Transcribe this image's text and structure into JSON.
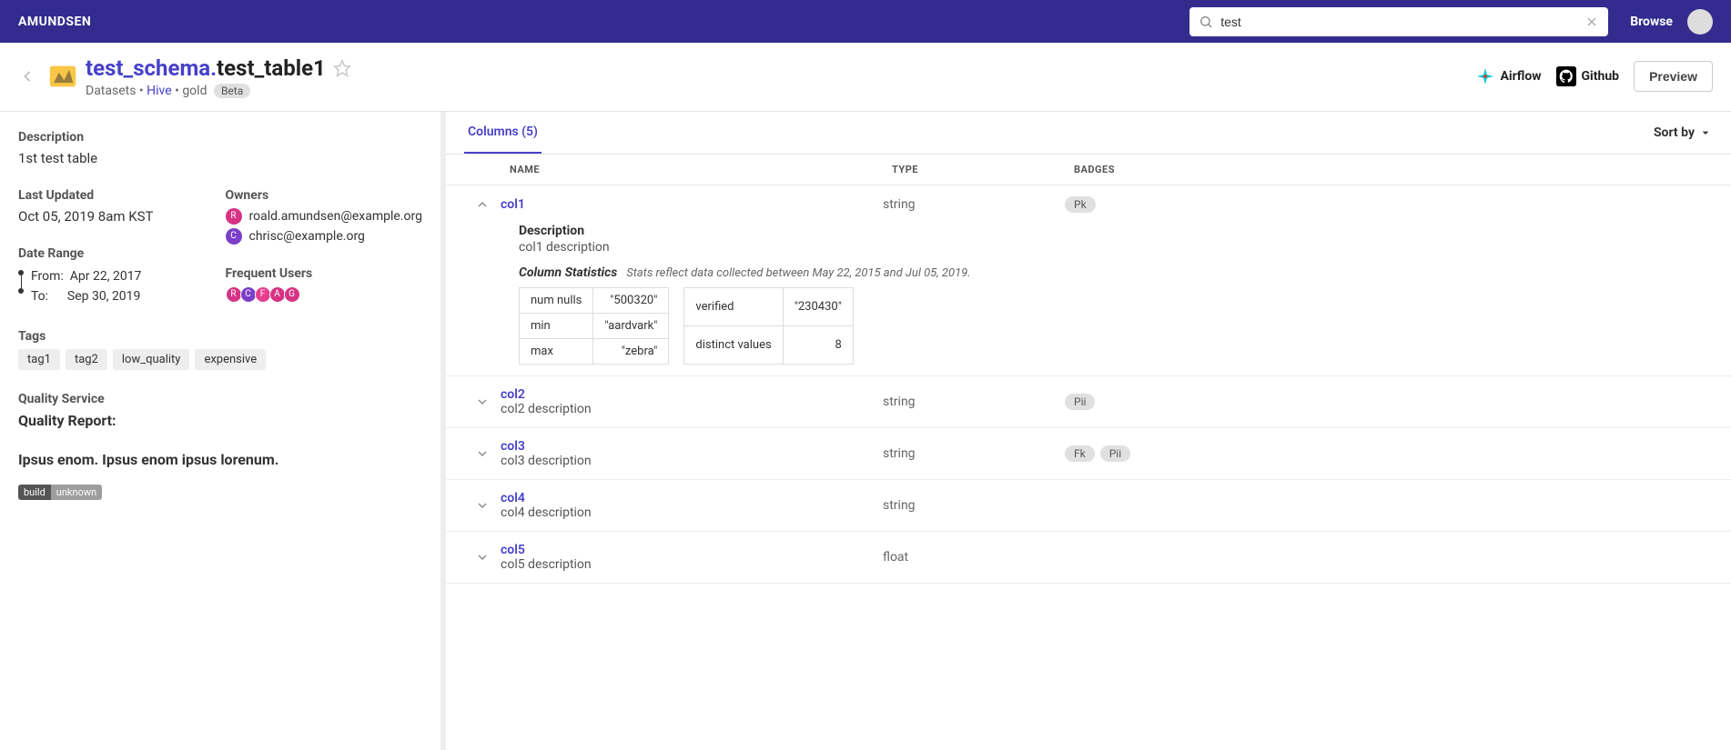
{
  "navbar": {
    "brand": "AMUNDSEN",
    "search_value": "test",
    "browse": "Browse"
  },
  "header": {
    "schema": "test_schema",
    "table": "test_table1",
    "breadcrumb_prefix": "Datasets",
    "breadcrumb_db": "Hive",
    "breadcrumb_tier": "gold",
    "beta": "Beta",
    "airflow": "Airflow",
    "github": "Github",
    "preview": "Preview"
  },
  "left": {
    "description_label": "Description",
    "description": "1st test table",
    "last_updated_label": "Last Updated",
    "last_updated": "Oct 05, 2019 8am KST",
    "owners_label": "Owners",
    "owners": [
      {
        "initial": "R",
        "class": "avatar-R",
        "email": "roald.amundsen@example.org"
      },
      {
        "initial": "C",
        "class": "avatar-C",
        "email": "chrisc@example.org"
      }
    ],
    "date_range_label": "Date Range",
    "date_from_label": "From:",
    "date_from": "Apr 22, 2017",
    "date_to_label": "To:",
    "date_to": "Sep 30, 2019",
    "freq_users_label": "Frequent Users",
    "freq_users": [
      {
        "initial": "R",
        "class": "avatar-R"
      },
      {
        "initial": "C",
        "class": "avatar-C"
      },
      {
        "initial": "F",
        "class": "avatar-F"
      },
      {
        "initial": "A",
        "class": "avatar-A"
      },
      {
        "initial": "G",
        "class": "avatar-G"
      }
    ],
    "tags_label": "Tags",
    "tags": [
      "tag1",
      "tag2",
      "low_quality",
      "expensive"
    ],
    "quality_service_label": "Quality Service",
    "quality_report": "Quality Report:",
    "ipsum": "Ipsus enom. Ipsus enom ipsus lorenum.",
    "build_left": "build",
    "build_right": "unknown"
  },
  "right": {
    "tab_columns": "Columns (5)",
    "sort_by": "Sort by",
    "headers": {
      "name": "NAME",
      "type": "TYPE",
      "badges": "BADGES"
    },
    "columns": [
      {
        "name": "col1",
        "type": "string",
        "badges": [
          "Pk"
        ],
        "expanded": true,
        "desc_label": "Description",
        "desc": "col1 description",
        "stats_title": "Column Statistics",
        "stats_note": "Stats reflect data collected between May 22, 2015 and Jul 05, 2019.",
        "stats_left": [
          {
            "k": "num nulls",
            "v": "\"500320\""
          },
          {
            "k": "min",
            "v": "\"aardvark\""
          },
          {
            "k": "max",
            "v": "\"zebra\""
          }
        ],
        "stats_right": [
          {
            "k": "verified",
            "v": "\"230430\""
          },
          {
            "k": "distinct values",
            "v": "8"
          }
        ]
      },
      {
        "name": "col2",
        "type": "string",
        "badges": [
          "Pii"
        ],
        "desc": "col2 description",
        "expanded": false
      },
      {
        "name": "col3",
        "type": "string",
        "badges": [
          "Fk",
          "Pii"
        ],
        "desc": "col3 description",
        "expanded": false
      },
      {
        "name": "col4",
        "type": "string",
        "badges": [],
        "desc": "col4 description",
        "expanded": false
      },
      {
        "name": "col5",
        "type": "float",
        "badges": [],
        "desc": "col5 description",
        "expanded": false
      }
    ]
  }
}
